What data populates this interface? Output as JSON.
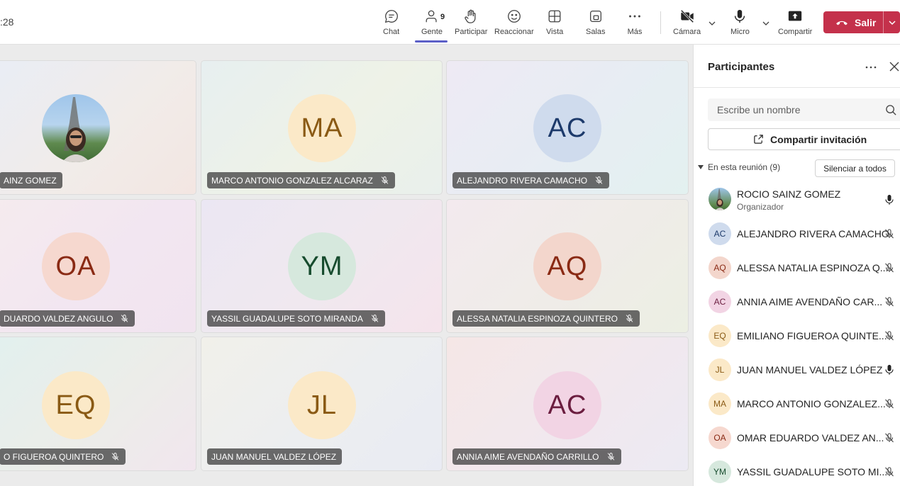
{
  "timer": ":28",
  "toolbar": {
    "chat": "Chat",
    "people": "Gente",
    "people_count": "9",
    "raise": "Participar",
    "react": "Reaccionar",
    "view": "Vista",
    "rooms": "Salas",
    "more": "Más",
    "camera": "Cámara",
    "mic": "Micro",
    "share": "Compartir",
    "leave": "Salir"
  },
  "tiles": [
    {
      "name": "AINZ GOMEZ",
      "initials": "",
      "photo": true
    },
    {
      "name": "MARCO ANTONIO GONZALEZ ALCARAZ",
      "initials": "MA"
    },
    {
      "name": "ALEJANDRO RIVERA CAMACHO",
      "initials": "AC"
    },
    {
      "name": "DUARDO VALDEZ ANGULO",
      "initials": "OA"
    },
    {
      "name": "YASSIL GUADALUPE SOTO MIRANDA",
      "initials": "YM"
    },
    {
      "name": "ALESSA NATALIA ESPINOZA QUINTERO",
      "initials": "AQ"
    },
    {
      "name": "O FIGUEROA QUINTERO",
      "initials": "EQ"
    },
    {
      "name": "JUAN MANUEL VALDEZ LÓPEZ",
      "initials": "JL"
    },
    {
      "name": "ANNIA AIME AVENDAÑO CARRILLO",
      "initials": "AC"
    }
  ],
  "panel": {
    "title": "Participantes",
    "search_placeholder": "Escribe un nombre",
    "share_invite": "Compartir invitación",
    "section_label": "En esta reunión (9)",
    "mute_all": "Silenciar a todos",
    "participants": [
      {
        "initials": "",
        "name": "ROCIO SAINZ GOMEZ",
        "role": "Organizador",
        "photo": true
      },
      {
        "initials": "AC",
        "name": "ALEJANDRO RIVERA CAMACHO"
      },
      {
        "initials": "AQ",
        "name": "ALESSA NATALIA ESPINOZA Q..."
      },
      {
        "initials": "AC",
        "name": "ANNIA AIME AVENDAÑO CAR..."
      },
      {
        "initials": "EQ",
        "name": "EMILIANO FIGUEROA QUINTE..."
      },
      {
        "initials": "JL",
        "name": "JUAN MANUEL VALDEZ LÓPEZ"
      },
      {
        "initials": "MA",
        "name": "MARCO ANTONIO GONZALEZ..."
      },
      {
        "initials": "OA",
        "name": "OMAR EDUARDO VALDEZ AN..."
      },
      {
        "initials": "YM",
        "name": "YASSIL GUADALUPE SOTO MI..."
      }
    ]
  },
  "colors": {
    "accent": "#5b5fc7",
    "leave": "#c4314b"
  }
}
